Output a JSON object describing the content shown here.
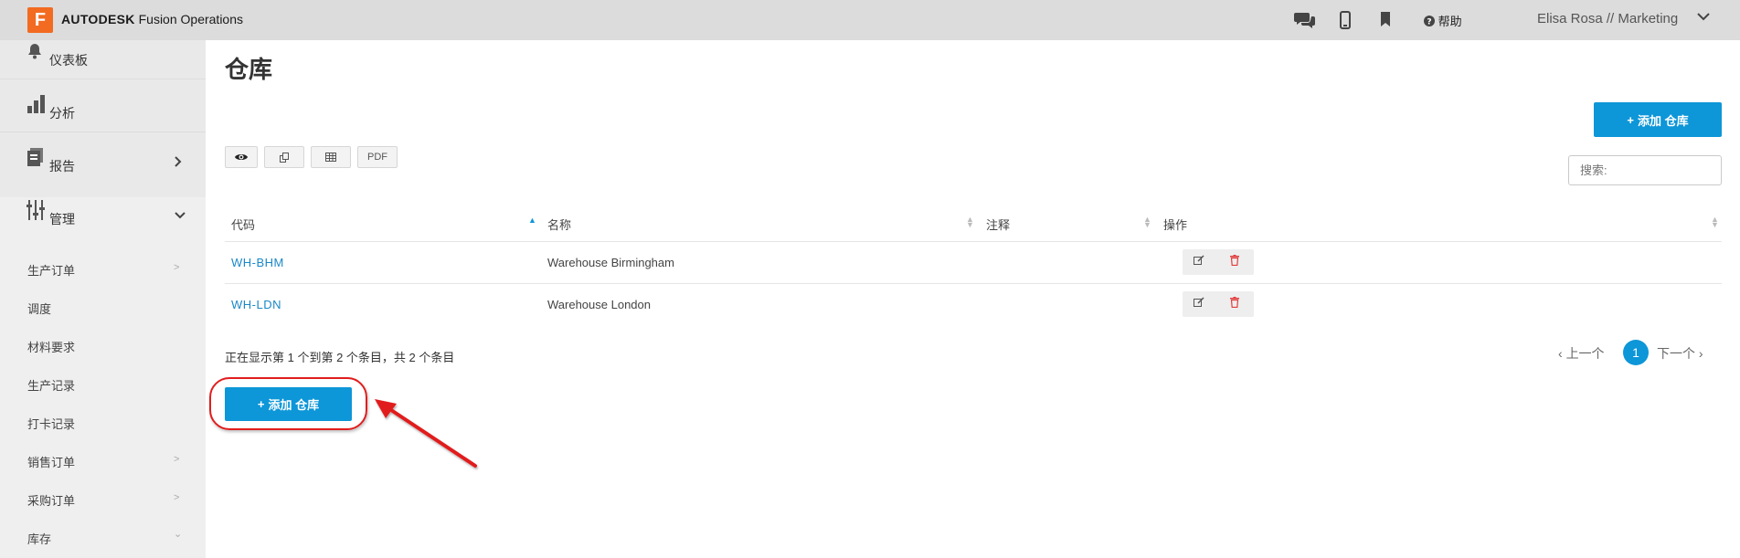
{
  "header": {
    "logo_letter": "F",
    "brand_bold": "AUTODESK",
    "brand_rest": " Fusion Operations",
    "help_label": "帮助",
    "user_label": "Elisa Rosa // Marketing",
    "icons": [
      "chat-icon",
      "mobile-icon",
      "bookmark-icon",
      "help-icon"
    ]
  },
  "sidebar": {
    "main_items": [
      {
        "label": "仪表板",
        "icon": "bell-icon"
      },
      {
        "label": "分析",
        "icon": "bar-chart-icon"
      },
      {
        "label": "报告",
        "icon": "report-icon"
      },
      {
        "label": "管理",
        "icon": "sliders-icon"
      }
    ],
    "sub_items": [
      {
        "label": "生产订单"
      },
      {
        "label": "调度"
      },
      {
        "label": "材料要求"
      },
      {
        "label": "生产记录"
      },
      {
        "label": "打卡记录"
      },
      {
        "label": "销售订单"
      },
      {
        "label": "采购订单"
      },
      {
        "label": "库存"
      }
    ]
  },
  "main": {
    "title": "仓库",
    "add_button_label": "添加 仓库",
    "toolbar": {
      "pdf_label": "PDF"
    },
    "search_placeholder": "搜索:",
    "columns": [
      "代码",
      "名称",
      "注释",
      "操作"
    ],
    "rows": [
      {
        "code": "WH-BHM",
        "name": "Warehouse Birmingham",
        "note": ""
      },
      {
        "code": "WH-LDN",
        "name": "Warehouse London",
        "note": ""
      }
    ],
    "info_text": "正在显示第 1 个到第 2 个条目，共 2 个条目",
    "pagination": {
      "prev": "上一个",
      "current": "1",
      "next": "下一个"
    }
  },
  "colors": {
    "accent": "#0d96d8",
    "brand_orange": "#f26b21",
    "annotation_red": "#e11d1d"
  }
}
